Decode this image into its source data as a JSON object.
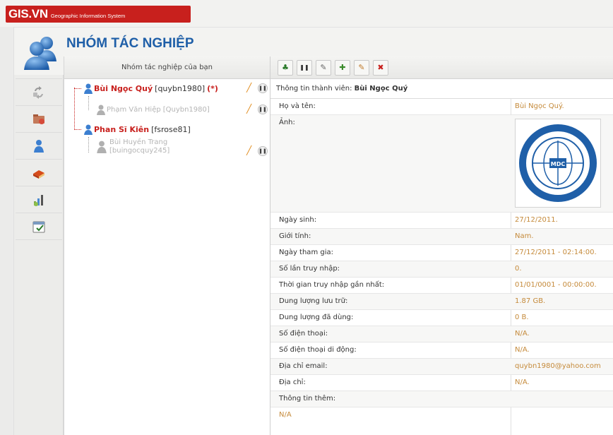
{
  "brand": {
    "logo": "GIS.VN",
    "subtitle": "Geographic Information System",
    "color": "#c8201d"
  },
  "page": {
    "title": "NHÓM TÁC NGHIỆP"
  },
  "left_nav": [
    "recycle-icon",
    "folder-icon",
    "user-icon",
    "book-icon",
    "chart-icon",
    "calendar-check-icon"
  ],
  "tree": {
    "header": "Nhóm tác nghiệp của bạn",
    "nodes": [
      {
        "name": "Bùi Ngọc Quý",
        "account": "[quybn1980]",
        "star": "(*)"
      },
      {
        "name": "Phạm Văn Hiệp",
        "account": "[Quybn1980]"
      },
      {
        "name": "Phan Sĩ Kiên",
        "account": "[fsrose81]"
      },
      {
        "name": "Bùi Huyền Trang",
        "account": "[buingocquy245]"
      }
    ]
  },
  "toolbar": [
    "add-user-icon",
    "pause-icon",
    "edit-icon",
    "add-member-icon",
    "edit-member-icon",
    "remove-member-icon"
  ],
  "detail": {
    "header_label": "Thông tin thành viên:",
    "header_name": "Bùi Ngọc Quý",
    "rows": [
      {
        "label": "Họ và tên:",
        "value": "Bùi Ngọc Quý."
      },
      {
        "label": "Ảnh:",
        "value": ""
      },
      {
        "label": "Ngày sinh:",
        "value": "27/12/2011."
      },
      {
        "label": "Giới tính:",
        "value": "Nam."
      },
      {
        "label": "Ngày tham gia:",
        "value": "27/12/2011 - 02:14:00."
      },
      {
        "label": "Số lần truy nhập:",
        "value": "0."
      },
      {
        "label": "Thời gian truy nhập gần nhất:",
        "value": "01/01/0001 - 00:00:00."
      },
      {
        "label": "Dung lượng lưu trữ:",
        "value": "1.87 GB."
      },
      {
        "label": "Dung lượng đã dùng:",
        "value": "0 B."
      },
      {
        "label": "Số điện thoại:",
        "value": "N/A."
      },
      {
        "label": "Số điện thoại di động:",
        "value": "N/A."
      },
      {
        "label": "Địa chỉ email:",
        "value": "quybn1980@yahoo.com"
      },
      {
        "label": "Địa chỉ:",
        "value": "N/A."
      },
      {
        "label": "Thông tin thêm:",
        "value": ""
      },
      {
        "label": "N/A",
        "value": ""
      }
    ],
    "logo": {
      "seal_text": "MDC"
    }
  }
}
